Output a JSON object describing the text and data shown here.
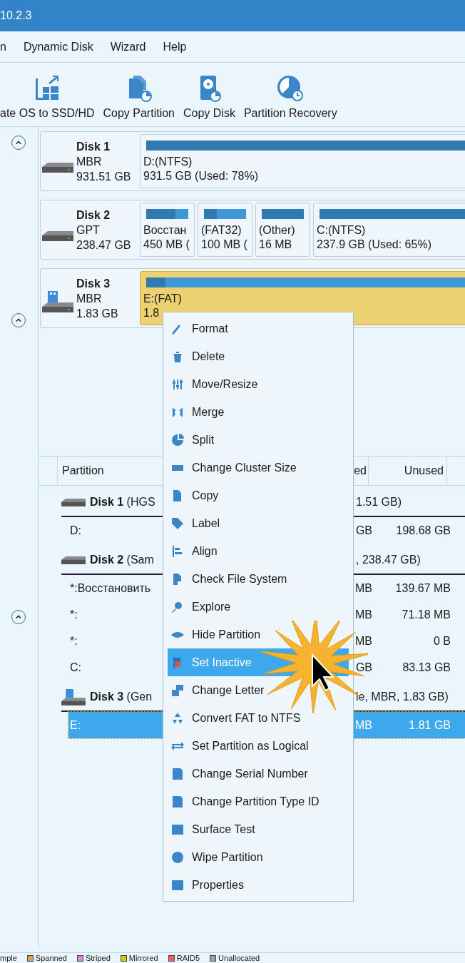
{
  "window": {
    "title": "10.2.3"
  },
  "menu_bar": [
    "n",
    "Dynamic Disk",
    "Wizard",
    "Help"
  ],
  "toolbar": [
    "ate OS to SSD/HD",
    "Copy Partition",
    "Copy Disk",
    "Partition Recovery"
  ],
  "disk_map": [
    {
      "name": "Disk 1",
      "style": "MBR",
      "size": "931.51 GB",
      "kind": "hdd",
      "selected": false,
      "partitions": [
        {
          "label": "D:(NTFS)",
          "info": "931.5 GB (Used: 78%)",
          "level": 0.78
        }
      ]
    },
    {
      "name": "Disk 2",
      "style": "GPT",
      "size": "238.47 GB",
      "kind": "hdd",
      "selected": false,
      "partitions": [
        {
          "label": "Восстан",
          "info": "450 MB (",
          "level": 0.7
        },
        {
          "label": "(FAT32)",
          "info": "100 MB (",
          "level": 0.3
        },
        {
          "label": "(Other)",
          "info": "16 MB",
          "level": 1
        },
        {
          "label": "C:(NTFS)",
          "info": "237.9 GB (Used: 65%)",
          "level": 0.65
        }
      ]
    },
    {
      "name": "Disk 3",
      "style": "MBR",
      "size": "1.83 GB",
      "kind": "usb",
      "selected": true,
      "partitions": [
        {
          "label": "E:(FAT)",
          "info": "1.8",
          "level": 0.04
        }
      ]
    }
  ],
  "table": {
    "columns": [
      "Partition",
      "ed",
      "Unused"
    ],
    "rows": [
      {
        "kind": "hdd",
        "name": "**Disk 1** (HGS",
        "tail": "1.51 GB)"
      },
      {
        "kind": "partition",
        "name": "D:",
        "used": "GB",
        "unused": "198.68 GB",
        "selected": false
      },
      {
        "kind": "hdd",
        "name": "**Disk 2** (Sam",
        "tail": ", 238.47 GB)"
      },
      {
        "kind": "partition",
        "name": "*:Восстановить",
        "used": "MB",
        "unused": "139.67 MB",
        "selected": false
      },
      {
        "kind": "partition",
        "name": "*:",
        "used": "MB",
        "unused": "71.18 MB",
        "selected": false
      },
      {
        "kind": "partition",
        "name": "*:",
        "used": "MB",
        "unused": "0 B",
        "selected": false
      },
      {
        "kind": "partition",
        "name": "C:",
        "used": "GB",
        "unused": "83.13 GB",
        "selected": false
      },
      {
        "kind": "usb",
        "name": "**Disk 3** (Gen",
        "tail": "le, MBR, 1.83 GB)"
      },
      {
        "kind": "partition",
        "name": "E:",
        "used": "MB",
        "unused": "1.81 GB",
        "selected": true
      }
    ]
  },
  "context_menu": [
    {
      "label": "Format",
      "selected": false
    },
    {
      "label": "Delete",
      "selected": false
    },
    {
      "label": "Move/Resize",
      "selected": false
    },
    {
      "label": "Merge",
      "selected": false
    },
    {
      "label": "Split",
      "selected": false
    },
    {
      "label": "Change Cluster Size",
      "selected": false
    },
    {
      "label": "Copy",
      "selected": false
    },
    {
      "label": "Label",
      "selected": false
    },
    {
      "label": "Align",
      "selected": false
    },
    {
      "label": "Check File System",
      "selected": false
    },
    {
      "label": "Explore",
      "selected": false
    },
    {
      "label": "Hide Partition",
      "selected": false
    },
    {
      "label": "Set Inactive",
      "selected": true
    },
    {
      "label": "Change Letter",
      "selected": false
    },
    {
      "label": "Convert FAT to NTFS",
      "selected": false
    },
    {
      "label": "Set Partition as Logical",
      "selected": false
    },
    {
      "label": "Change Serial Number",
      "selected": false
    },
    {
      "label": "Change Partition Type ID",
      "selected": false
    },
    {
      "label": "Surface Test",
      "selected": false
    },
    {
      "label": "Wipe Partition",
      "selected": false
    },
    {
      "label": "Properties",
      "selected": false
    }
  ],
  "legend": [
    {
      "label": "mple"
    },
    {
      "label": "Spanned",
      "color": "#d9a05b"
    },
    {
      "label": "Striped",
      "color": "#d58ae0"
    },
    {
      "label": "Mirrored",
      "color": "#d4c800"
    },
    {
      "label": "RAID5",
      "color": "#f06060"
    },
    {
      "label": "Unallocated",
      "color": "#a0a0a0"
    }
  ]
}
